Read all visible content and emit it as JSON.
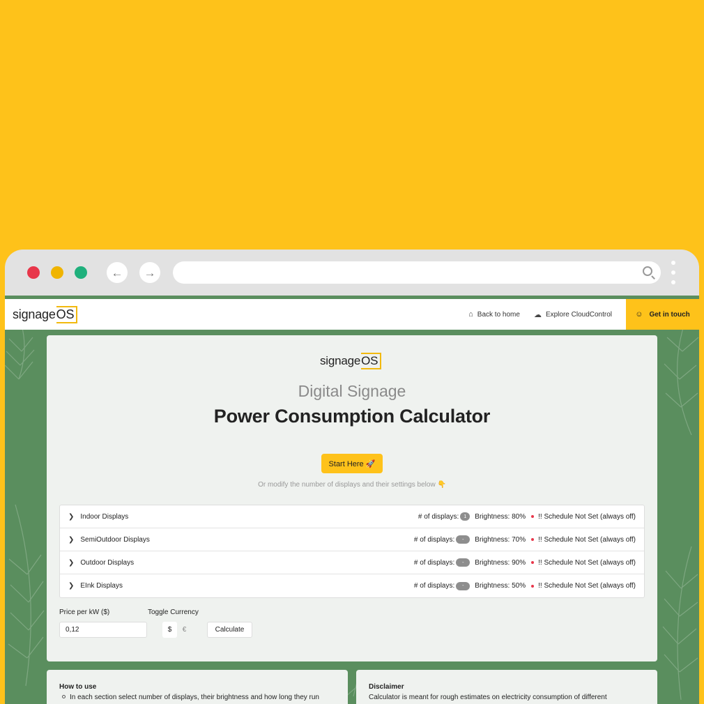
{
  "colors": {
    "background": "#FEC21A",
    "accent": "#FEC21A",
    "page_green": "#5A8E5E",
    "card": "#EFF2EF",
    "status_red": "#E8364A"
  },
  "browser": {
    "back_icon": "arrow-left-icon",
    "forward_icon": "arrow-right-icon",
    "search_icon": "search-icon",
    "menu_icon": "kebab-menu-icon"
  },
  "nav": {
    "logo_main": "signage",
    "logo_os": "OS",
    "back_home": "Back to home",
    "explore": "Explore CloudControl",
    "cta": "Get in touch"
  },
  "hero": {
    "logo_main": "signage",
    "logo_os": "OS",
    "subtitle": "Digital Signage",
    "title": "Power Consumption Calculator",
    "start_button": "Start Here 🚀",
    "hint": "Or modify the number of displays and their settings below 👇"
  },
  "displays": [
    {
      "name": "Indoor Displays",
      "count_label": "# of displays:",
      "count": "1",
      "brightness": "Brightness: 80%",
      "schedule": "!! Schedule Not Set (always off)"
    },
    {
      "name": "SemiOutdoor Displays",
      "count_label": "# of displays:",
      "count": "-",
      "brightness": "Brightness: 70%",
      "schedule": "!! Schedule Not Set (always off)"
    },
    {
      "name": "Outdoor Displays",
      "count_label": "# of displays:",
      "count": "-",
      "brightness": "Brightness: 90%",
      "schedule": "!! Schedule Not Set (always off)"
    },
    {
      "name": "EInk Displays",
      "count_label": "# of displays:",
      "count": "-",
      "brightness": "Brightness: 50%",
      "schedule": "!! Schedule Not Set (always off)"
    }
  ],
  "pricing": {
    "price_label": "Price per kW ($)",
    "price_value": "0,12",
    "currency_label": "Toggle Currency",
    "usd": "$",
    "eur": "€",
    "calculate": "Calculate"
  },
  "how_to": {
    "title": "How to use",
    "text": "In each section select number of displays, their brightness and how long they run"
  },
  "disclaimer": {
    "title": "Disclaimer",
    "text": "Calculator is meant for rough estimates on electricity consumption of different"
  }
}
